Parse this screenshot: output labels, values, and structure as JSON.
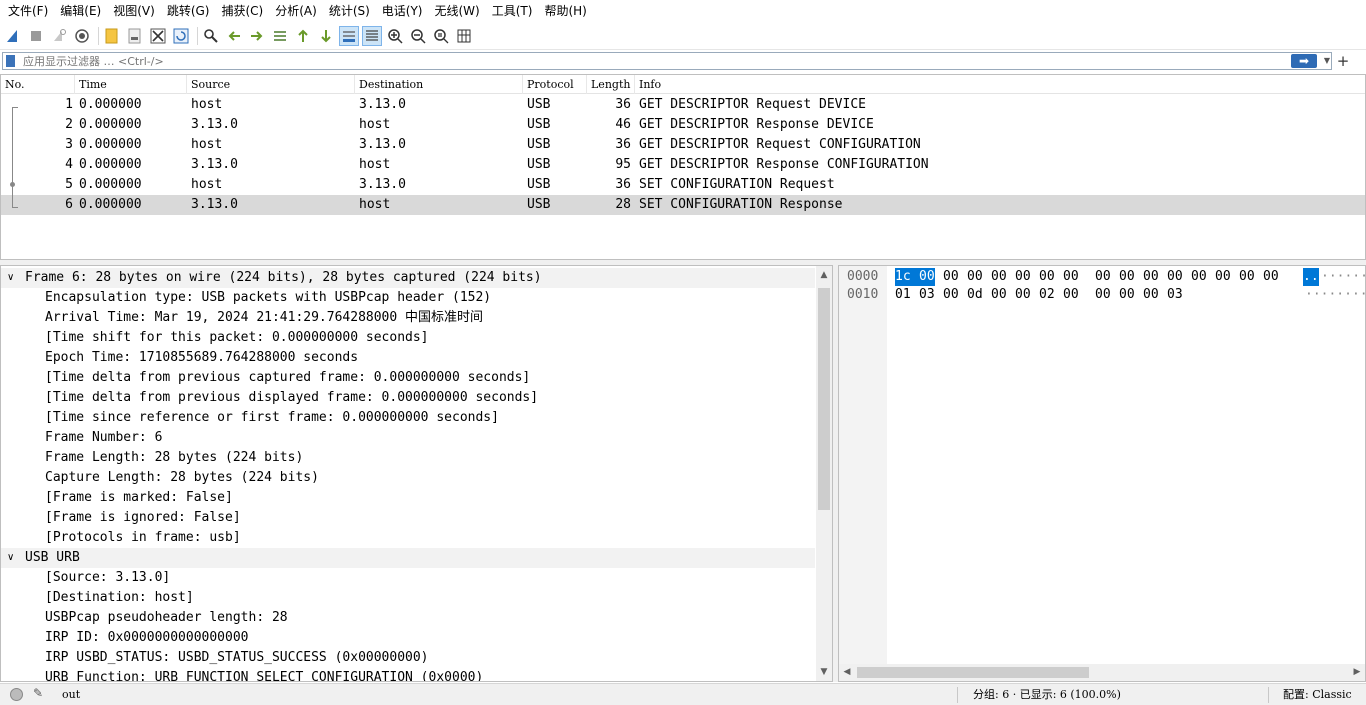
{
  "menu": [
    "文件(F)",
    "编辑(E)",
    "视图(V)",
    "跳转(G)",
    "捕获(C)",
    "分析(A)",
    "统计(S)",
    "电话(Y)",
    "无线(W)",
    "工具(T)",
    "帮助(H)"
  ],
  "toolbar": {
    "icons": [
      "shark-fin-start-icon",
      "stop-icon",
      "restart-icon",
      "capture-options-icon",
      "open-file-icon",
      "file-set-icon",
      "close-file-icon",
      "reload-icon",
      "find-packet-icon",
      "go-back-icon",
      "go-forward-icon",
      "go-to-packet-icon",
      "first-packet-icon",
      "last-packet-icon",
      "auto-scroll-icon",
      "colorize-icon",
      "zoom-in-icon",
      "zoom-out-icon",
      "normal-size-icon",
      "resize-columns-icon"
    ]
  },
  "filter": {
    "placeholder": "应用显示过滤器 … <Ctrl-/>",
    "apply_glyph": "➡",
    "dropdown_glyph": "▼",
    "add_glyph": "+"
  },
  "packet_list": {
    "columns": [
      "No.",
      "Time",
      "Source",
      "Destination",
      "Protocol",
      "Length",
      "Info"
    ],
    "rows": [
      {
        "no": "1",
        "time": "0.000000",
        "source": "host",
        "destination": "3.13.0",
        "protocol": "USB",
        "length": "36",
        "info": "GET DESCRIPTOR Request DEVICE"
      },
      {
        "no": "2",
        "time": "0.000000",
        "source": "3.13.0",
        "destination": "host",
        "protocol": "USB",
        "length": "46",
        "info": "GET DESCRIPTOR Response DEVICE"
      },
      {
        "no": "3",
        "time": "0.000000",
        "source": "host",
        "destination": "3.13.0",
        "protocol": "USB",
        "length": "36",
        "info": "GET DESCRIPTOR Request CONFIGURATION"
      },
      {
        "no": "4",
        "time": "0.000000",
        "source": "3.13.0",
        "destination": "host",
        "protocol": "USB",
        "length": "95",
        "info": "GET DESCRIPTOR Response CONFIGURATION"
      },
      {
        "no": "5",
        "time": "0.000000",
        "source": "host",
        "destination": "3.13.0",
        "protocol": "USB",
        "length": "36",
        "info": "SET CONFIGURATION Request"
      },
      {
        "no": "6",
        "time": "0.000000",
        "source": "3.13.0",
        "destination": "host",
        "protocol": "USB",
        "length": "28",
        "info": "SET CONFIGURATION Response"
      }
    ],
    "selected_row": 6
  },
  "details": {
    "lines": [
      {
        "text": "Frame 6: 28 bytes on wire (224 bits), 28 bytes captured (224 bits)",
        "level": 0,
        "toggle": "∨"
      },
      {
        "text": "Encapsulation type: USB packets with USBPcap header (152)",
        "level": 1
      },
      {
        "text": "Arrival Time: Mar 19, 2024 21:41:29.764288000 中国标准时间",
        "level": 1
      },
      {
        "text": "[Time shift for this packet: 0.000000000 seconds]",
        "level": 1
      },
      {
        "text": "Epoch Time: 1710855689.764288000 seconds",
        "level": 1
      },
      {
        "text": "[Time delta from previous captured frame: 0.000000000 seconds]",
        "level": 1
      },
      {
        "text": "[Time delta from previous displayed frame: 0.000000000 seconds]",
        "level": 1
      },
      {
        "text": "[Time since reference or first frame: 0.000000000 seconds]",
        "level": 1
      },
      {
        "text": "Frame Number: 6",
        "level": 1
      },
      {
        "text": "Frame Length: 28 bytes (224 bits)",
        "level": 1
      },
      {
        "text": "Capture Length: 28 bytes (224 bits)",
        "level": 1
      },
      {
        "text": "[Frame is marked: False]",
        "level": 1
      },
      {
        "text": "[Frame is ignored: False]",
        "level": 1
      },
      {
        "text": "[Protocols in frame: usb]",
        "level": 1
      },
      {
        "text": "USB URB",
        "level": 0,
        "toggle": "∨"
      },
      {
        "text": "[Source: 3.13.0]",
        "level": 1
      },
      {
        "text": "[Destination: host]",
        "level": 1
      },
      {
        "text": "USBPcap pseudoheader length: 28",
        "level": 1
      },
      {
        "text": "IRP ID: 0x0000000000000000",
        "level": 1
      },
      {
        "text": "IRP USBD_STATUS: USBD_STATUS_SUCCESS (0x00000000)",
        "level": 1
      },
      {
        "text": "URB Function: URB_FUNCTION_SELECT_CONFIGURATION (0x0000)",
        "level": 1
      }
    ]
  },
  "hex": {
    "rows": [
      {
        "offset": "0000",
        "bytes": [
          "1c",
          "00",
          "00",
          "00",
          "00",
          "00",
          "00",
          "00",
          "00",
          "00",
          "00",
          "00",
          "00",
          "00",
          "00",
          "00"
        ],
        "ascii": [
          "..",
          "······"
        ]
      },
      {
        "offset": "0010",
        "bytes": [
          "01",
          "03",
          "00",
          "0d",
          "00",
          "00",
          "02",
          "00",
          "00",
          "00",
          "00",
          "03"
        ],
        "ascii": [
          "",
          "········"
        ]
      }
    ],
    "selected_bytes": 2
  },
  "status": {
    "edit_icon": "✎",
    "file": "out",
    "packets": "分组: 6 · 已显示: 6 (100.0%)",
    "profile": "配置: Classic"
  },
  "colors": {
    "selection": "#0078d7",
    "selected_row": "#d9d9d9",
    "accent": "#2e6bb5"
  }
}
